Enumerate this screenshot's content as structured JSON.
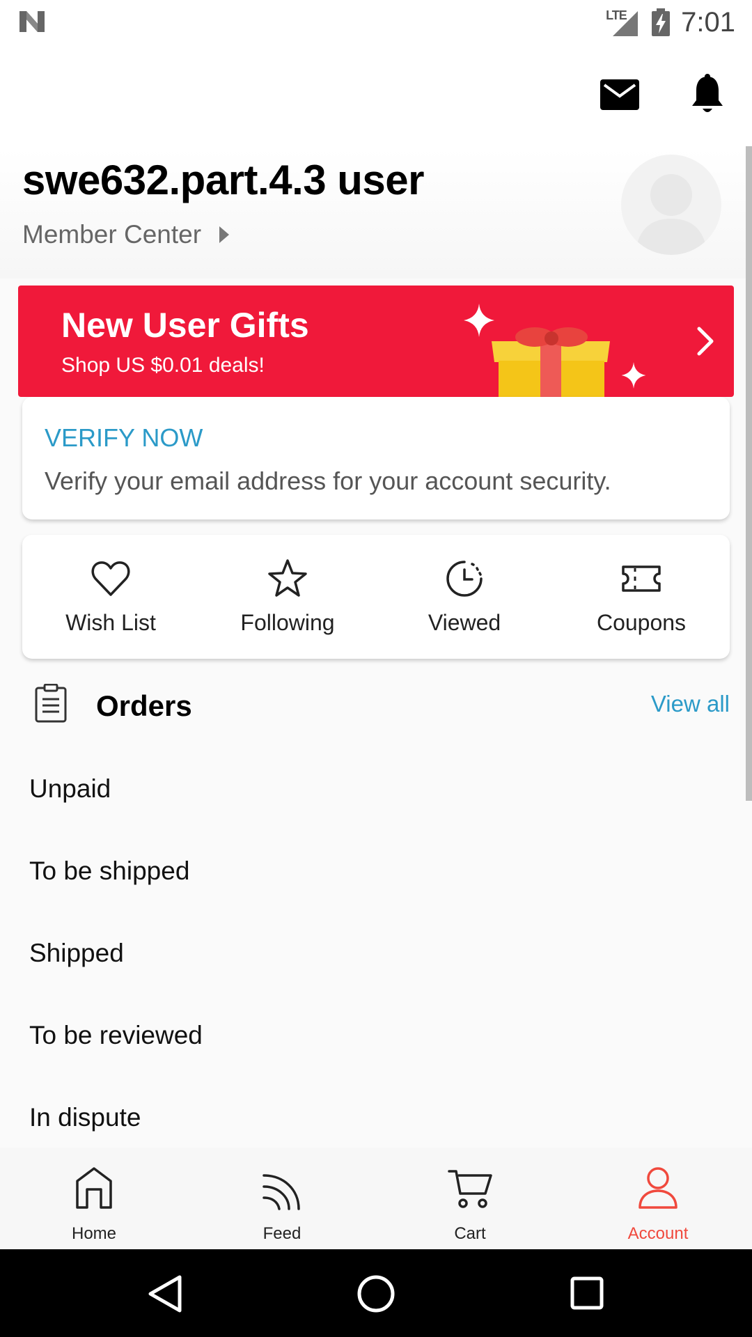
{
  "status_bar": {
    "network": "LTE",
    "time": "7:01"
  },
  "header": {
    "mail_icon": "mail-icon",
    "bell_icon": "bell-icon"
  },
  "profile": {
    "user_name": "swe632.part.4.3 user",
    "member_center": "Member Center"
  },
  "banner": {
    "title": "New User Gifts",
    "subtitle": "Shop US $0.01 deals!",
    "color": "#f0193a"
  },
  "verify": {
    "title": "VERIFY NOW",
    "text": "Verify your email address for your account security."
  },
  "quick_links": [
    {
      "label": "Wish List",
      "icon": "heart-icon"
    },
    {
      "label": "Following",
      "icon": "star-icon"
    },
    {
      "label": "Viewed",
      "icon": "clock-icon"
    },
    {
      "label": "Coupons",
      "icon": "ticket-icon"
    }
  ],
  "orders": {
    "title": "Orders",
    "view_all": "View all",
    "items": [
      "Unpaid",
      "To be shipped",
      "Shipped",
      "To be reviewed",
      "In dispute"
    ]
  },
  "bottom_nav": [
    {
      "label": "Home",
      "icon": "home-icon"
    },
    {
      "label": "Feed",
      "icon": "feed-icon"
    },
    {
      "label": "Cart",
      "icon": "cart-icon"
    },
    {
      "label": "Account",
      "icon": "account-icon",
      "active": true
    }
  ],
  "colors": {
    "accent_link": "#2b9ac8",
    "active_tab": "#f0493d"
  }
}
